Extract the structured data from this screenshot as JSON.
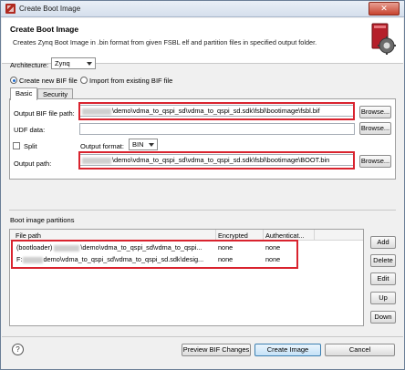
{
  "window": {
    "title": "Create Boot Image",
    "close_glyph": "✕"
  },
  "header": {
    "title": "Create Boot Image",
    "description": "Creates Zynq Boot Image in .bin format from given FSBL elf and partition files in specified output folder.",
    "icon": "boot-image-gear-icon"
  },
  "architecture": {
    "label": "Architecture:",
    "value": "Zynq"
  },
  "bif_mode": {
    "options": [
      {
        "label": "Create new BIF file",
        "checked": true
      },
      {
        "label": "Import from existing BIF file",
        "checked": false
      }
    ]
  },
  "tabs": [
    {
      "label": "Basic",
      "active": true
    },
    {
      "label": "Security",
      "active": false
    }
  ],
  "basic": {
    "output_bif": {
      "label": "Output BIF file path:",
      "value": "\\demo\\vdma_to_qspi_sd\\vdma_to_qspi_sd.sdk\\fsbl\\bootimage\\fsbl.bif",
      "browse": "Browse..."
    },
    "udf": {
      "label": "UDF data:",
      "value": "",
      "browse": "Browse..."
    },
    "split": {
      "label": "Split",
      "checked": false
    },
    "output_format": {
      "label": "Output format:",
      "value": "BIN"
    },
    "output_path": {
      "label": "Output path:",
      "value": "\\demo\\vdma_to_qspi_sd\\vdma_to_qspi_sd.sdk\\fsbl\\bootimage\\BOOT.bin",
      "browse": "Browse..."
    }
  },
  "partitions": {
    "label": "Boot image partitions",
    "columns": [
      "File path",
      "Encrypted",
      "Authenticat..."
    ],
    "rows": [
      {
        "file_prefix": "(bootloader)",
        "file_path": "\\demo\\vdma_to_qspi_sd\\vdma_to_qspi...",
        "encrypted": "none",
        "authenticated": "none"
      },
      {
        "file_prefix": "F:",
        "file_path": "demo\\vdma_to_qspi_sd\\vdma_to_qspi_sd.sdk\\desig...",
        "encrypted": "none",
        "authenticated": "none"
      }
    ],
    "buttons": {
      "add": "Add",
      "delete": "Delete",
      "edit": "Edit",
      "up": "Up",
      "down": "Down"
    }
  },
  "footer": {
    "help": "?",
    "preview": "Preview BIF Changes",
    "create": "Create Image",
    "cancel": "Cancel"
  },
  "colors": {
    "highlight": "#d9232e",
    "accent": "#1f6dd0",
    "title_bar": "#dce6f1"
  }
}
